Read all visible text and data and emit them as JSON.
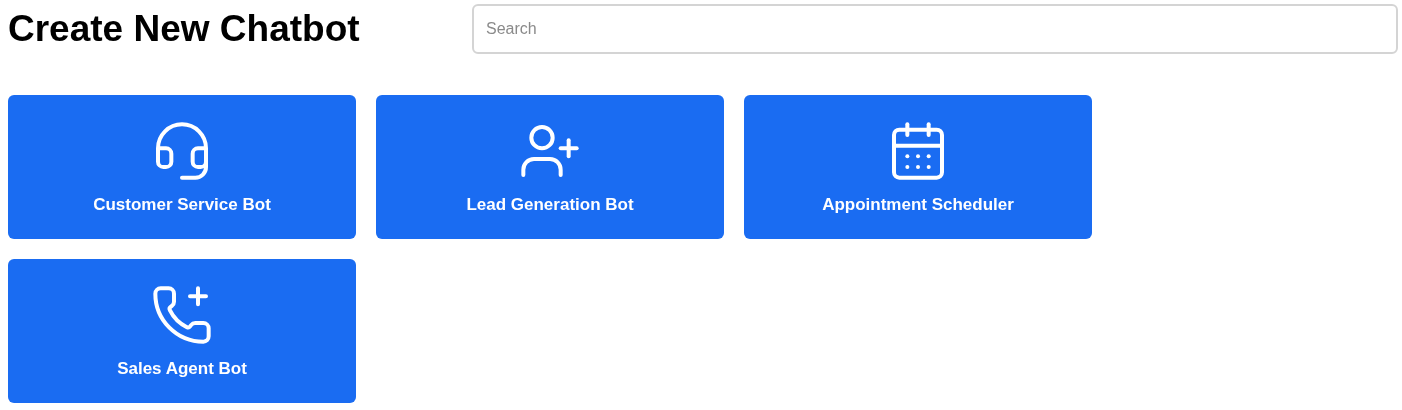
{
  "title": "Create New Chatbot",
  "search": {
    "placeholder": "Search"
  },
  "cards": [
    {
      "label": "Customer Service Bot",
      "kind": "support"
    },
    {
      "label": "Lead Generation Bot",
      "kind": "lead"
    },
    {
      "label": "Appointment Scheduler",
      "kind": "scheduler"
    },
    {
      "label": "Sales Agent Bot",
      "kind": "sales"
    }
  ]
}
